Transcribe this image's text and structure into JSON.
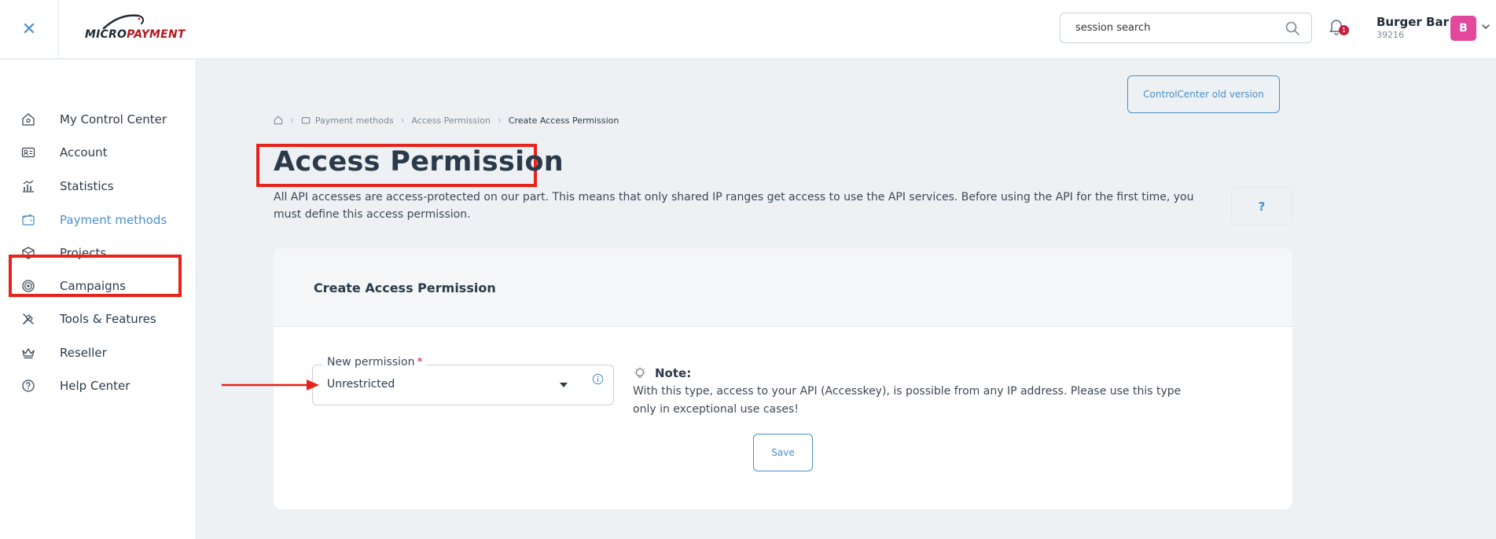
{
  "header": {
    "close_label": "✕",
    "logo": {
      "part1": "MICRO",
      "part2": "PAYMENT"
    },
    "search": {
      "value": "session search",
      "placeholder": "session search"
    },
    "notifications": {
      "count": "1"
    },
    "user": {
      "name": "Burger Bar",
      "id": "39216",
      "avatar_letter": "B"
    }
  },
  "sidebar": {
    "items": [
      {
        "label": "My Control Center",
        "icon": "home-icon"
      },
      {
        "label": "Account",
        "icon": "id-card-icon"
      },
      {
        "label": "Statistics",
        "icon": "chart-icon"
      },
      {
        "label": "Payment methods",
        "icon": "wallet-icon",
        "active": true
      },
      {
        "label": "Projects",
        "icon": "box-icon"
      },
      {
        "label": "Campaigns",
        "icon": "target-icon"
      },
      {
        "label": "Tools & Features",
        "icon": "tools-icon"
      },
      {
        "label": "Reseller",
        "icon": "crown-icon"
      },
      {
        "label": "Help Center",
        "icon": "help-circle-icon"
      }
    ]
  },
  "main": {
    "old_version_label": "ControlCenter old version",
    "breadcrumb": [
      "Payment methods",
      "Access Permission",
      "Create Access Permission"
    ],
    "title": "Access Permission",
    "intro": "All API accesses are access-protected on our part. This means that only shared IP ranges get access to use the API services. Before using the API for the first time, you must define this access permission.",
    "help_label": "?",
    "card": {
      "title": "Create Access Permission",
      "field_label": "New permission",
      "required_mark": "*",
      "field_value": "Unrestricted",
      "note_title": "Note:",
      "note_text": "With this type, access to your API (Accesskey), is possible from any IP address. Please use this type only in exceptional use cases!",
      "save_label": "Save"
    }
  },
  "colors": {
    "accent": "#4a90c9",
    "highlight": "#e8231a",
    "avatar": "#e2489b",
    "badge": "#c0203e",
    "logo_red": "#b3191f"
  }
}
